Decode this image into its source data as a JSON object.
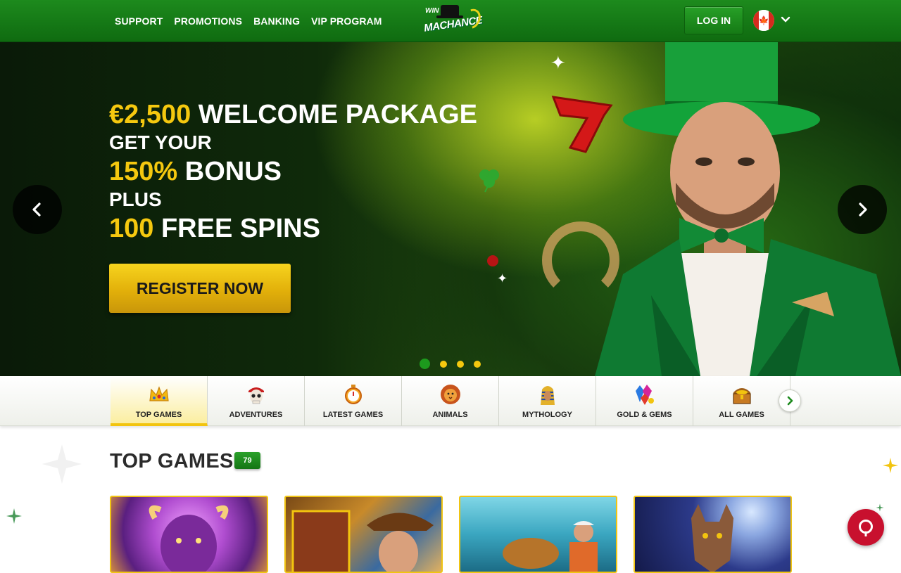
{
  "header": {
    "nav": [
      "SUPPORT",
      "PROMOTIONS",
      "BANKING",
      "VIP PROGRAM"
    ],
    "logo": {
      "line1": "WIN",
      "line2": "MACHANCE"
    },
    "login_label": "LOG IN",
    "country_icon": "canada-flag-icon"
  },
  "hero": {
    "amount": "€2,500",
    "title": "WELCOME PACKAGE",
    "line2": "GET YOUR",
    "bonus_pct": "150%",
    "bonus_word": "BONUS",
    "plus": "PLUS",
    "spins_count": "100",
    "spins_word": "FREE SPINS",
    "cta": "REGISTER NOW",
    "slide_count": 4,
    "active_slide": 1,
    "accent_color": "#f5c80f"
  },
  "categories": {
    "items": [
      {
        "label": "TOP GAMES",
        "icon": "crown-icon",
        "active": true
      },
      {
        "label": "ADVENTURES",
        "icon": "pirate-skull-icon",
        "active": false
      },
      {
        "label": "LATEST GAMES",
        "icon": "stopwatch-icon",
        "active": false
      },
      {
        "label": "ANIMALS",
        "icon": "lion-icon",
        "active": false
      },
      {
        "label": "MYTHOLOGY",
        "icon": "pharaoh-icon",
        "active": false
      },
      {
        "label": "GOLD & GEMS",
        "icon": "gems-icon",
        "active": false
      },
      {
        "label": "ALL GAMES",
        "icon": "treasure-chest-icon",
        "active": false
      }
    ]
  },
  "top_games": {
    "title": "TOP GAMES",
    "count": "79",
    "games": [
      {
        "theme": "buffalo"
      },
      {
        "theme": "egyptian-adventure"
      },
      {
        "theme": "fishing"
      },
      {
        "theme": "wolf-moon"
      }
    ]
  },
  "colors": {
    "brand_green": "#1d8a1d",
    "gold": "#f5c80f",
    "chat_red": "#c8102e"
  }
}
